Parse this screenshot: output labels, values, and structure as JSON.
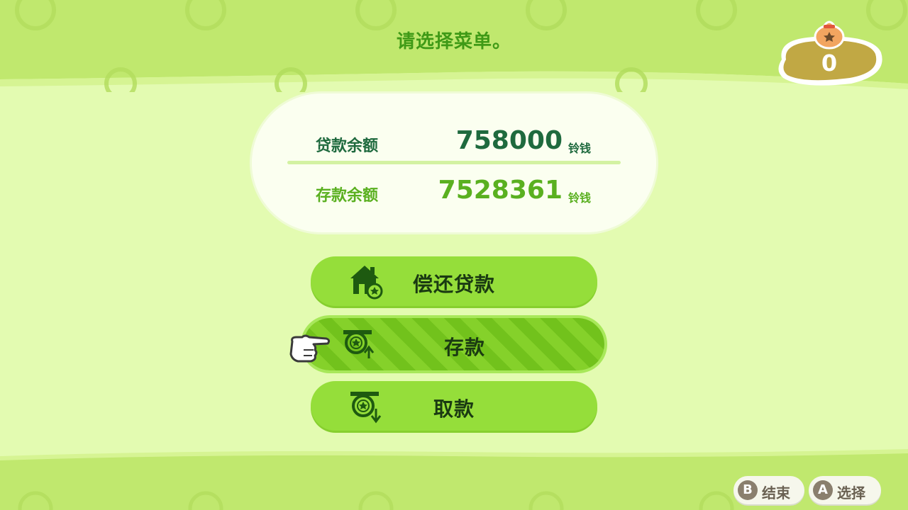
{
  "header": {
    "title": "请选择菜单。",
    "bells_value": "0"
  },
  "balances": {
    "loan": {
      "label": "贷款余额",
      "value": "758000",
      "unit": "铃钱"
    },
    "savings": {
      "label": "存款余额",
      "value": "7528361",
      "unit": "铃钱"
    }
  },
  "menu": {
    "items": [
      {
        "label": "偿还贷款",
        "icon": "house-loan-icon",
        "selected": false
      },
      {
        "label": "存款",
        "icon": "deposit-coin-icon",
        "selected": true
      },
      {
        "label": "取款",
        "icon": "withdraw-coin-icon",
        "selected": false
      }
    ]
  },
  "hints": [
    {
      "key": "B",
      "label": "结束"
    },
    {
      "key": "A",
      "label": "选择"
    }
  ],
  "colors": {
    "background": "#e3fbb1",
    "band": "#c0e86e",
    "button": "#95de3a",
    "button_selected": "#72c21c",
    "loan_text": "#1f6a3e",
    "savings_text": "#5ab020",
    "title_text": "#3f9a16",
    "bells_badge": "#c1a844"
  }
}
